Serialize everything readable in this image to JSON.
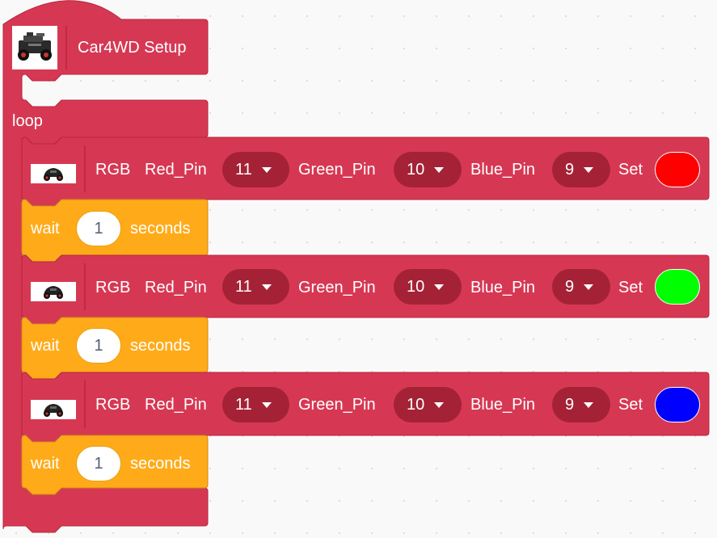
{
  "setup_block": {
    "title": "Car4WD Setup",
    "icon": "car4wd-robot-icon"
  },
  "loop_block": {
    "label": "loop"
  },
  "rgb_blocks": [
    {
      "icon": "car-icon",
      "rgb_label": "RGB",
      "red_label": "Red_Pin",
      "red_value": "11",
      "green_label": "Green_Pin",
      "green_value": "10",
      "blue_label": "Blue_Pin",
      "blue_value": "9",
      "set_label": "Set",
      "color": "#ff0000"
    },
    {
      "icon": "car-icon",
      "rgb_label": "RGB",
      "red_label": "Red_Pin",
      "red_value": "11",
      "green_label": "Green_Pin",
      "green_value": "10",
      "blue_label": "Blue_Pin",
      "blue_value": "9",
      "set_label": "Set",
      "color": "#00ff00"
    },
    {
      "icon": "car-icon",
      "rgb_label": "RGB",
      "red_label": "Red_Pin",
      "red_value": "11",
      "green_label": "Green_Pin",
      "green_value": "10",
      "blue_label": "Blue_Pin",
      "blue_value": "9",
      "set_label": "Set",
      "color": "#0000ff"
    }
  ],
  "wait_blocks": [
    {
      "wait_label": "wait",
      "value": "1",
      "unit_label": "seconds"
    },
    {
      "wait_label": "wait",
      "value": "1",
      "unit_label": "seconds"
    },
    {
      "wait_label": "wait",
      "value": "1",
      "unit_label": "seconds"
    }
  ],
  "colors": {
    "block_red": "#d63853",
    "block_red_dark": "#a52236",
    "block_outline": "#b8243c",
    "wait_orange": "#ffab19",
    "wait_outline": "#cf8b17"
  }
}
